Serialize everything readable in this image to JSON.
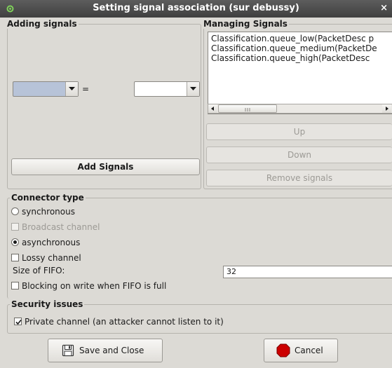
{
  "window": {
    "title": "Setting signal association (sur debussy)",
    "close_glyph": "×"
  },
  "adding": {
    "legend": "Adding signals",
    "left_value": "",
    "equals": "=",
    "right_value": "",
    "add_label": "Add Signals"
  },
  "managing": {
    "legend": "Managing Signals",
    "items": [
      "Classification.queue_low(PacketDesc p",
      "Classification.queue_medium(PacketDe",
      "Classification.queue_high(PacketDesc"
    ],
    "up_label": "Up",
    "down_label": "Down",
    "remove_label": "Remove signals"
  },
  "connector": {
    "legend": "Connector type",
    "synchronous": "synchronous",
    "broadcast": "Broadcast channel",
    "asynchronous": "asynchronous",
    "lossy": "Lossy channel",
    "fifo_label": "Size of FIFO:",
    "fifo_value": "32",
    "blocking": "Blocking on write when FIFO is full",
    "selected": "asynchronous"
  },
  "security": {
    "legend": "Security issues",
    "private": "Private channel (an attacker cannot listen to it)",
    "private_checked": true
  },
  "footer": {
    "save_label": "Save and Close",
    "cancel_label": "Cancel"
  },
  "colors": {
    "title_bg": "#4a4a4a",
    "window_bg": "#dcdad5",
    "combo_fill": "#b7c3d8",
    "cancel_red": "#cc0000"
  }
}
